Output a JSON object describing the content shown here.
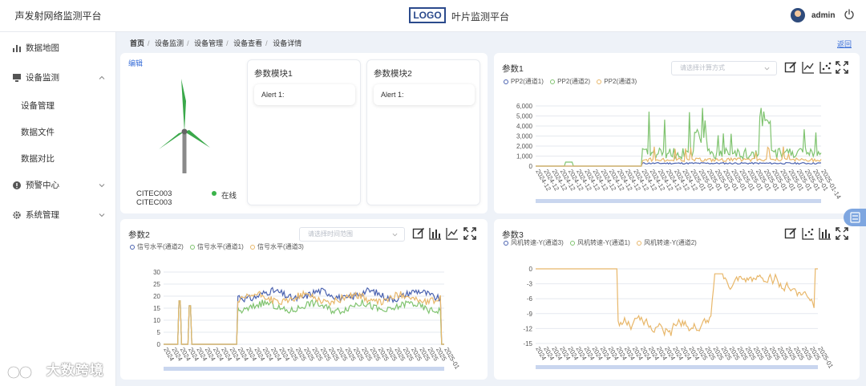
{
  "header": {
    "brand": "声发射网络监测平台",
    "logo_text": "LOGO",
    "title": "叶片监测平台",
    "user": "admin"
  },
  "sidebar": {
    "items": [
      {
        "label": "数据地图",
        "icon": "bar-chart-icon"
      },
      {
        "label": "设备监测",
        "icon": "monitor-icon",
        "expanded": true
      },
      {
        "label": "预警中心",
        "icon": "alert-icon"
      },
      {
        "label": "系统管理",
        "icon": "gear-icon"
      }
    ],
    "subitems": [
      "设备管理",
      "数据文件",
      "数据对比"
    ]
  },
  "breadcrumb": [
    "首页",
    "设备监测",
    "设备管理",
    "设备查看",
    "设备详情"
  ],
  "back_label": "返回",
  "device": {
    "edit_label": "编辑",
    "ids": [
      "CITEC003",
      "CITEC003"
    ],
    "status": "在线",
    "status_color": "#3ab34a",
    "modules": [
      {
        "title": "参数模块1",
        "alert": "Alert 1:"
      },
      {
        "title": "参数模块2",
        "alert": "Alert 1:"
      }
    ]
  },
  "colors": {
    "blue": "#4a62b0",
    "green": "#7fc36f",
    "orange": "#e8b76a",
    "accent": "#3a6fd8"
  },
  "chart_data": [
    {
      "type": "line",
      "title": "参数1",
      "select_placeholder": "请选择计算方式",
      "series": [
        {
          "name": "PP2(通道1)",
          "color": "#4a62b0"
        },
        {
          "name": "PP2(通道2)",
          "color": "#7fc36f"
        },
        {
          "name": "PP2(通道3)",
          "color": "#e8b76a"
        }
      ],
      "ylim": [
        0,
        6000
      ],
      "yticks": [
        "0",
        "1,000",
        "2,000",
        "3,000",
        "4,000",
        "5,000",
        "6,000"
      ],
      "xticks": [
        "2024-12",
        "2024-12",
        "2024-12",
        "2024-12",
        "2024-12",
        "2024-12",
        "2024-12",
        "2024-12",
        "2024-12",
        "2024-12",
        "2024-12",
        "2024-12",
        "2024-12",
        "2024-12",
        "2024-12",
        "2024-12",
        "2024-12",
        "2024-12",
        "2024-12",
        "2025-01",
        "2025-01",
        "2025-01",
        "2025-01",
        "2025-01",
        "2025-01",
        "2025-01",
        "2025-01",
        "2025-01",
        "2025-01",
        "2025-01",
        "2025-01",
        "2025-01",
        "2025-01",
        "2025-01",
        "2025-01",
        "2025-01-14"
      ],
      "grid": true
    },
    {
      "type": "line",
      "title": "参数2",
      "select_placeholder": "请选择时间范围",
      "series": [
        {
          "name": "信号水平(通道2)",
          "color": "#4a62b0"
        },
        {
          "name": "信号水平(通道1)",
          "color": "#7fc36f"
        },
        {
          "name": "信号水平(通道3)",
          "color": "#e8b76a"
        }
      ],
      "ylim": [
        0,
        30
      ],
      "yticks": [
        "0",
        "5",
        "10",
        "15",
        "20",
        "25",
        "30"
      ],
      "xticks": [
        "2024",
        "2024",
        "2024",
        "2024",
        "2024",
        "2024",
        "2024",
        "2024",
        "2024",
        "2024",
        "2024",
        "2024",
        "2024",
        "2024",
        "2024",
        "2025",
        "2025",
        "2025",
        "2025",
        "2025",
        "2025",
        "2025",
        "2025",
        "2025",
        "2025",
        "2025",
        "2025",
        "2025",
        "2025",
        "2025",
        "2025",
        "2025",
        "2025",
        "2025",
        "2025-01"
      ],
      "grid": true
    },
    {
      "type": "line",
      "title": "参数3",
      "series": [
        {
          "name": "风机转速-Y(通道3)",
          "color": "#4a62b0"
        },
        {
          "name": "风机转速-Y(通道1)",
          "color": "#7fc36f"
        },
        {
          "name": "风机转速-Y(通道2)",
          "color": "#e8b76a"
        }
      ],
      "ylim": [
        -15,
        0
      ],
      "yticks": [
        "0",
        "-3",
        "-6",
        "-9",
        "-12",
        "-15"
      ],
      "xticks": [
        "2024",
        "2024",
        "2024",
        "2024",
        "2024",
        "2024",
        "2024",
        "2024",
        "2024",
        "2024",
        "2024",
        "2024",
        "2024",
        "2024",
        "2024",
        "2024",
        "2024",
        "2024",
        "2024",
        "2024",
        "2025",
        "2025",
        "2025",
        "2025",
        "2025",
        "2025",
        "2025",
        "2025",
        "2025",
        "2025",
        "2025",
        "2025",
        "2025",
        "2025",
        "2025",
        "2025-01"
      ],
      "grid": true
    }
  ],
  "watermark": "大数跨境"
}
